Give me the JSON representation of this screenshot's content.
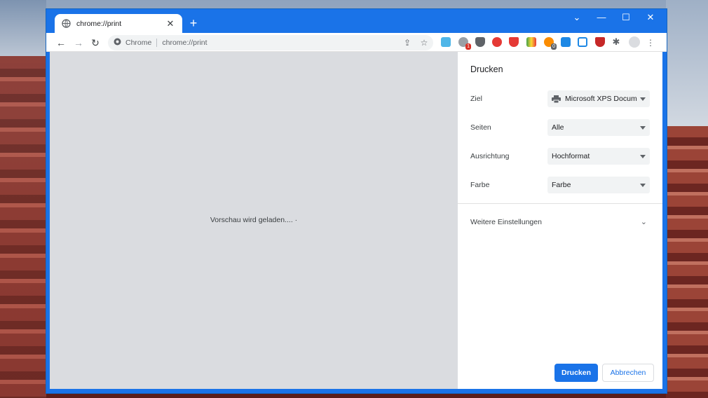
{
  "tab": {
    "title": "chrome://print",
    "close": "✕",
    "new_tab": "+"
  },
  "window_controls": {
    "menu": "⌄",
    "minimize": "—",
    "maximize": "☐",
    "close": "✕"
  },
  "toolbar": {
    "back": "←",
    "forward": "→",
    "reload": "↻",
    "site_chip": "Chrome",
    "url": "chrome://print",
    "share": "⇪",
    "bookmark": "☆",
    "menu": "⋮"
  },
  "extensions": [
    {
      "name": "image-ext-icon",
      "color": "#4fb6e8",
      "badge": ""
    },
    {
      "name": "notifier-ext-icon",
      "color": "#9aa0a6",
      "badge": "1"
    },
    {
      "name": "shield-ext-icon",
      "color": "#5f6368",
      "badge": ""
    },
    {
      "name": "adblock-ext-icon",
      "color": "#e53935",
      "badge": ""
    },
    {
      "name": "brave-ext-icon",
      "color": "#e53935",
      "badge": ""
    },
    {
      "name": "colorful-ext-icon",
      "color": "#43a047",
      "badge": ""
    },
    {
      "name": "orange-ext-icon",
      "color": "#fb8c00",
      "badge": "0"
    },
    {
      "name": "s-ext-icon",
      "color": "#1e88e5",
      "badge": ""
    },
    {
      "name": "calendar-ext-icon",
      "color": "#1e88e5",
      "badge": ""
    },
    {
      "name": "mcafee-ext-icon",
      "color": "#c62828",
      "badge": ""
    },
    {
      "name": "puzzle-icon",
      "color": "#5f6368",
      "badge": ""
    }
  ],
  "preview": {
    "message": "Vorschau wird geladen.... ·"
  },
  "print_panel": {
    "title": "Drucken",
    "destination": {
      "label": "Ziel",
      "value": "Microsoft XPS Docum"
    },
    "pages": {
      "label": "Seiten",
      "value": "Alle"
    },
    "orientation": {
      "label": "Ausrichtung",
      "value": "Hochformat"
    },
    "color": {
      "label": "Farbe",
      "value": "Farbe"
    },
    "more_settings": "Weitere Einstellungen",
    "print_button": "Drucken",
    "cancel_button": "Abbrechen"
  }
}
